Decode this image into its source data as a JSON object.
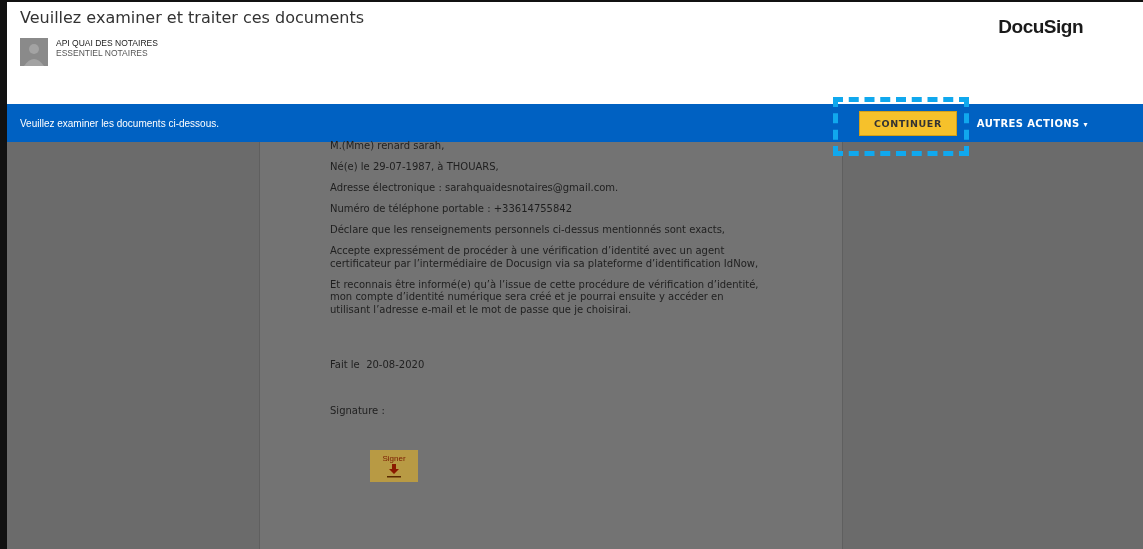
{
  "header": {
    "title": "Veuillez examiner et traiter ces documents",
    "sender_name": "API QUAI DES NOTAIRES",
    "sender_company": "ESSENTIEL NOTAIRES",
    "logo": "DocuSign"
  },
  "action_bar": {
    "message": "Veuillez examiner les documents ci-dessous.",
    "primary_button": "CONTINUER",
    "primary_highlighted": true,
    "menu_button": "AUTRES ACTIONS",
    "menu_caret": "▾"
  },
  "document": {
    "paragraphs": [
      "M.(Mme) renard sarah,",
      "Né(e) le 29-07-1987, à THOUARS,",
      "Adresse électronique : sarahquaidesnotaires@gmail.com.",
      "Numéro de téléphone portable : +33614755842",
      "Déclare que les renseignements personnels ci-dessus mentionnés sont exacts,",
      "Accepte expressément de procéder à une vérification d’identité avec un agent certificateur par l’intermédiaire de Docusign via sa plateforme d’identification IdNow,",
      " Et reconnais être informé(e) qu’à l’issue de cette procédure de vérification d’identité, mon compte d’identité numérique sera créé et je pourrai ensuite y accéder en utilisant l’adresse e-mail et le mot de passe que je choisirai."
    ],
    "date_label": "Fait le",
    "date_value": "20-08-2020",
    "signature_label": "Signature :",
    "sign_tag": "Signer"
  }
}
